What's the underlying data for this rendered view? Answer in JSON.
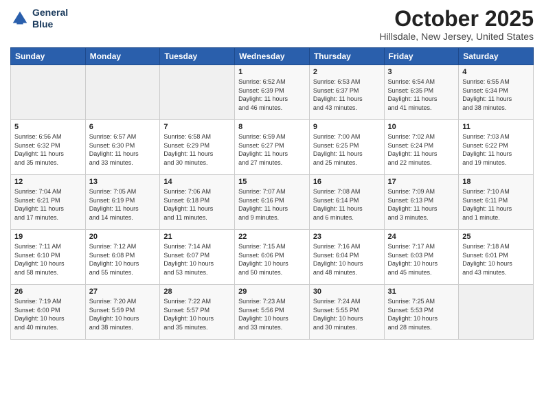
{
  "header": {
    "logo_line1": "General",
    "logo_line2": "Blue",
    "month": "October 2025",
    "location": "Hillsdale, New Jersey, United States"
  },
  "weekdays": [
    "Sunday",
    "Monday",
    "Tuesday",
    "Wednesday",
    "Thursday",
    "Friday",
    "Saturday"
  ],
  "weeks": [
    [
      {
        "day": "",
        "info": ""
      },
      {
        "day": "",
        "info": ""
      },
      {
        "day": "",
        "info": ""
      },
      {
        "day": "1",
        "info": "Sunrise: 6:52 AM\nSunset: 6:39 PM\nDaylight: 11 hours\nand 46 minutes."
      },
      {
        "day": "2",
        "info": "Sunrise: 6:53 AM\nSunset: 6:37 PM\nDaylight: 11 hours\nand 43 minutes."
      },
      {
        "day": "3",
        "info": "Sunrise: 6:54 AM\nSunset: 6:35 PM\nDaylight: 11 hours\nand 41 minutes."
      },
      {
        "day": "4",
        "info": "Sunrise: 6:55 AM\nSunset: 6:34 PM\nDaylight: 11 hours\nand 38 minutes."
      }
    ],
    [
      {
        "day": "5",
        "info": "Sunrise: 6:56 AM\nSunset: 6:32 PM\nDaylight: 11 hours\nand 35 minutes."
      },
      {
        "day": "6",
        "info": "Sunrise: 6:57 AM\nSunset: 6:30 PM\nDaylight: 11 hours\nand 33 minutes."
      },
      {
        "day": "7",
        "info": "Sunrise: 6:58 AM\nSunset: 6:29 PM\nDaylight: 11 hours\nand 30 minutes."
      },
      {
        "day": "8",
        "info": "Sunrise: 6:59 AM\nSunset: 6:27 PM\nDaylight: 11 hours\nand 27 minutes."
      },
      {
        "day": "9",
        "info": "Sunrise: 7:00 AM\nSunset: 6:25 PM\nDaylight: 11 hours\nand 25 minutes."
      },
      {
        "day": "10",
        "info": "Sunrise: 7:02 AM\nSunset: 6:24 PM\nDaylight: 11 hours\nand 22 minutes."
      },
      {
        "day": "11",
        "info": "Sunrise: 7:03 AM\nSunset: 6:22 PM\nDaylight: 11 hours\nand 19 minutes."
      }
    ],
    [
      {
        "day": "12",
        "info": "Sunrise: 7:04 AM\nSunset: 6:21 PM\nDaylight: 11 hours\nand 17 minutes."
      },
      {
        "day": "13",
        "info": "Sunrise: 7:05 AM\nSunset: 6:19 PM\nDaylight: 11 hours\nand 14 minutes."
      },
      {
        "day": "14",
        "info": "Sunrise: 7:06 AM\nSunset: 6:18 PM\nDaylight: 11 hours\nand 11 minutes."
      },
      {
        "day": "15",
        "info": "Sunrise: 7:07 AM\nSunset: 6:16 PM\nDaylight: 11 hours\nand 9 minutes."
      },
      {
        "day": "16",
        "info": "Sunrise: 7:08 AM\nSunset: 6:14 PM\nDaylight: 11 hours\nand 6 minutes."
      },
      {
        "day": "17",
        "info": "Sunrise: 7:09 AM\nSunset: 6:13 PM\nDaylight: 11 hours\nand 3 minutes."
      },
      {
        "day": "18",
        "info": "Sunrise: 7:10 AM\nSunset: 6:11 PM\nDaylight: 11 hours\nand 1 minute."
      }
    ],
    [
      {
        "day": "19",
        "info": "Sunrise: 7:11 AM\nSunset: 6:10 PM\nDaylight: 10 hours\nand 58 minutes."
      },
      {
        "day": "20",
        "info": "Sunrise: 7:12 AM\nSunset: 6:08 PM\nDaylight: 10 hours\nand 55 minutes."
      },
      {
        "day": "21",
        "info": "Sunrise: 7:14 AM\nSunset: 6:07 PM\nDaylight: 10 hours\nand 53 minutes."
      },
      {
        "day": "22",
        "info": "Sunrise: 7:15 AM\nSunset: 6:06 PM\nDaylight: 10 hours\nand 50 minutes."
      },
      {
        "day": "23",
        "info": "Sunrise: 7:16 AM\nSunset: 6:04 PM\nDaylight: 10 hours\nand 48 minutes."
      },
      {
        "day": "24",
        "info": "Sunrise: 7:17 AM\nSunset: 6:03 PM\nDaylight: 10 hours\nand 45 minutes."
      },
      {
        "day": "25",
        "info": "Sunrise: 7:18 AM\nSunset: 6:01 PM\nDaylight: 10 hours\nand 43 minutes."
      }
    ],
    [
      {
        "day": "26",
        "info": "Sunrise: 7:19 AM\nSunset: 6:00 PM\nDaylight: 10 hours\nand 40 minutes."
      },
      {
        "day": "27",
        "info": "Sunrise: 7:20 AM\nSunset: 5:59 PM\nDaylight: 10 hours\nand 38 minutes."
      },
      {
        "day": "28",
        "info": "Sunrise: 7:22 AM\nSunset: 5:57 PM\nDaylight: 10 hours\nand 35 minutes."
      },
      {
        "day": "29",
        "info": "Sunrise: 7:23 AM\nSunset: 5:56 PM\nDaylight: 10 hours\nand 33 minutes."
      },
      {
        "day": "30",
        "info": "Sunrise: 7:24 AM\nSunset: 5:55 PM\nDaylight: 10 hours\nand 30 minutes."
      },
      {
        "day": "31",
        "info": "Sunrise: 7:25 AM\nSunset: 5:53 PM\nDaylight: 10 hours\nand 28 minutes."
      },
      {
        "day": "",
        "info": ""
      }
    ]
  ]
}
